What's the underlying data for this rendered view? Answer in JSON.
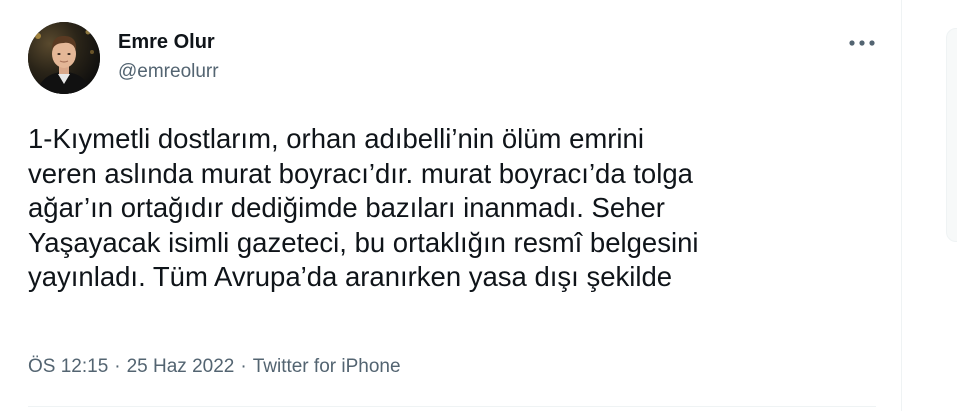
{
  "author": {
    "name": "Emre Olur",
    "handle": "@emreolurr"
  },
  "tweet": {
    "text_lines": [
      "1-Kıymetli dostlarım, orhan adıbelli’nin ölüm emrini",
      "veren aslında murat boyracı’dır. murat boyracı’da tolga",
      "ağar’ın ortağıdır dediğimde bazıları inanmadı. Seher",
      "Yaşayacak isimli gazeteci, bu ortaklığın resmî belgesini",
      "yayınladı. Tüm Avrupa’da aranırken yasa dışı şekilde"
    ]
  },
  "meta": {
    "time": "ÖS 12:15",
    "separator": "·",
    "date": "25 Haz 2022",
    "source": "Twitter for iPhone"
  },
  "icons": {
    "more": "more-horizontal-icon",
    "avatar": "profile-photo"
  },
  "colors": {
    "text_primary": "#0f1419",
    "text_secondary": "#536471",
    "border": "#eff3f4"
  }
}
